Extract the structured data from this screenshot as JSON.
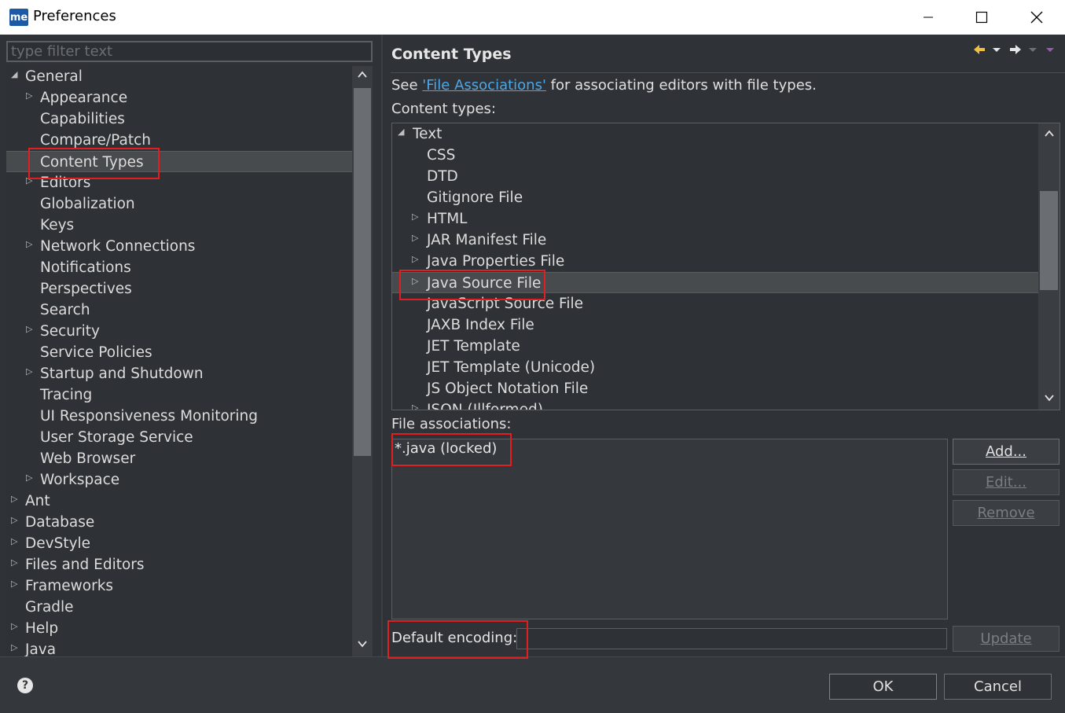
{
  "window": {
    "logo": "me",
    "title": "Preferences",
    "minimize_icon": "minimize-icon",
    "maximize_icon": "maximize-icon",
    "close_icon": "close-icon"
  },
  "sidebar": {
    "filter_placeholder": "type filter text",
    "items": [
      {
        "label": "General",
        "level": 0,
        "twisty": "expanded"
      },
      {
        "label": "Appearance",
        "level": 1,
        "twisty": "collapsed"
      },
      {
        "label": "Capabilities",
        "level": 1,
        "twisty": "none"
      },
      {
        "label": "Compare/Patch",
        "level": 1,
        "twisty": "none"
      },
      {
        "label": "Content Types",
        "level": 1,
        "twisty": "none",
        "selected": true
      },
      {
        "label": "Editors",
        "level": 1,
        "twisty": "collapsed"
      },
      {
        "label": "Globalization",
        "level": 1,
        "twisty": "none"
      },
      {
        "label": "Keys",
        "level": 1,
        "twisty": "none"
      },
      {
        "label": "Network Connections",
        "level": 1,
        "twisty": "collapsed"
      },
      {
        "label": "Notifications",
        "level": 1,
        "twisty": "none"
      },
      {
        "label": "Perspectives",
        "level": 1,
        "twisty": "none"
      },
      {
        "label": "Search",
        "level": 1,
        "twisty": "none"
      },
      {
        "label": "Security",
        "level": 1,
        "twisty": "collapsed"
      },
      {
        "label": "Service Policies",
        "level": 1,
        "twisty": "none"
      },
      {
        "label": "Startup and Shutdown",
        "level": 1,
        "twisty": "collapsed"
      },
      {
        "label": "Tracing",
        "level": 1,
        "twisty": "none"
      },
      {
        "label": "UI Responsiveness Monitoring",
        "level": 1,
        "twisty": "none"
      },
      {
        "label": "User Storage Service",
        "level": 1,
        "twisty": "none"
      },
      {
        "label": "Web Browser",
        "level": 1,
        "twisty": "none"
      },
      {
        "label": "Workspace",
        "level": 1,
        "twisty": "collapsed"
      },
      {
        "label": "Ant",
        "level": 0,
        "twisty": "collapsed"
      },
      {
        "label": "Database",
        "level": 0,
        "twisty": "collapsed"
      },
      {
        "label": "DevStyle",
        "level": 0,
        "twisty": "collapsed"
      },
      {
        "label": "Files and Editors",
        "level": 0,
        "twisty": "collapsed"
      },
      {
        "label": "Frameworks",
        "level": 0,
        "twisty": "collapsed"
      },
      {
        "label": "Gradle",
        "level": 0,
        "twisty": "none"
      },
      {
        "label": "Help",
        "level": 0,
        "twisty": "collapsed"
      },
      {
        "label": "Java",
        "level": 0,
        "twisty": "collapsed"
      }
    ]
  },
  "main": {
    "title": "Content Types",
    "nav_icons": [
      "back-arrow-icon",
      "back-menu-icon",
      "forward-arrow-icon",
      "forward-menu-icon",
      "view-menu-icon"
    ],
    "see_prefix": "See ",
    "see_link": "'File Associations'",
    "see_suffix": " for associating editors with file types.",
    "content_types_label": "Content types:",
    "content_types": [
      {
        "label": "Text",
        "level": 0,
        "twisty": "expanded"
      },
      {
        "label": "CSS",
        "level": 1,
        "twisty": "none"
      },
      {
        "label": "DTD",
        "level": 1,
        "twisty": "none"
      },
      {
        "label": "Gitignore File",
        "level": 1,
        "twisty": "none"
      },
      {
        "label": "HTML",
        "level": 1,
        "twisty": "collapsed"
      },
      {
        "label": "JAR Manifest File",
        "level": 1,
        "twisty": "collapsed"
      },
      {
        "label": "Java Properties File",
        "level": 1,
        "twisty": "collapsed"
      },
      {
        "label": "Java Source File",
        "level": 1,
        "twisty": "collapsed",
        "selected": true
      },
      {
        "label": "JavaScript Source File",
        "level": 1,
        "twisty": "none"
      },
      {
        "label": "JAXB Index File",
        "level": 1,
        "twisty": "none"
      },
      {
        "label": "JET Template",
        "level": 1,
        "twisty": "none"
      },
      {
        "label": "JET Template (Unicode)",
        "level": 1,
        "twisty": "none"
      },
      {
        "label": "JS Object Notation File",
        "level": 1,
        "twisty": "none"
      },
      {
        "label": "JSON (Illformed)",
        "level": 1,
        "twisty": "collapsed"
      }
    ],
    "file_assoc_label": "File associations:",
    "file_associations": [
      "*.java (locked)"
    ],
    "buttons": {
      "add": "Add...",
      "edit": "Edit...",
      "remove": "Remove",
      "update": "Update"
    },
    "encoding_label": "Default encoding:",
    "encoding_value": ""
  },
  "footer": {
    "help_icon": "help-icon",
    "ok": "OK",
    "cancel": "Cancel"
  },
  "colors": {
    "background": "#2f3236",
    "link": "#4aa8ea",
    "highlight": "#e02020",
    "selection": "#484b4e"
  }
}
